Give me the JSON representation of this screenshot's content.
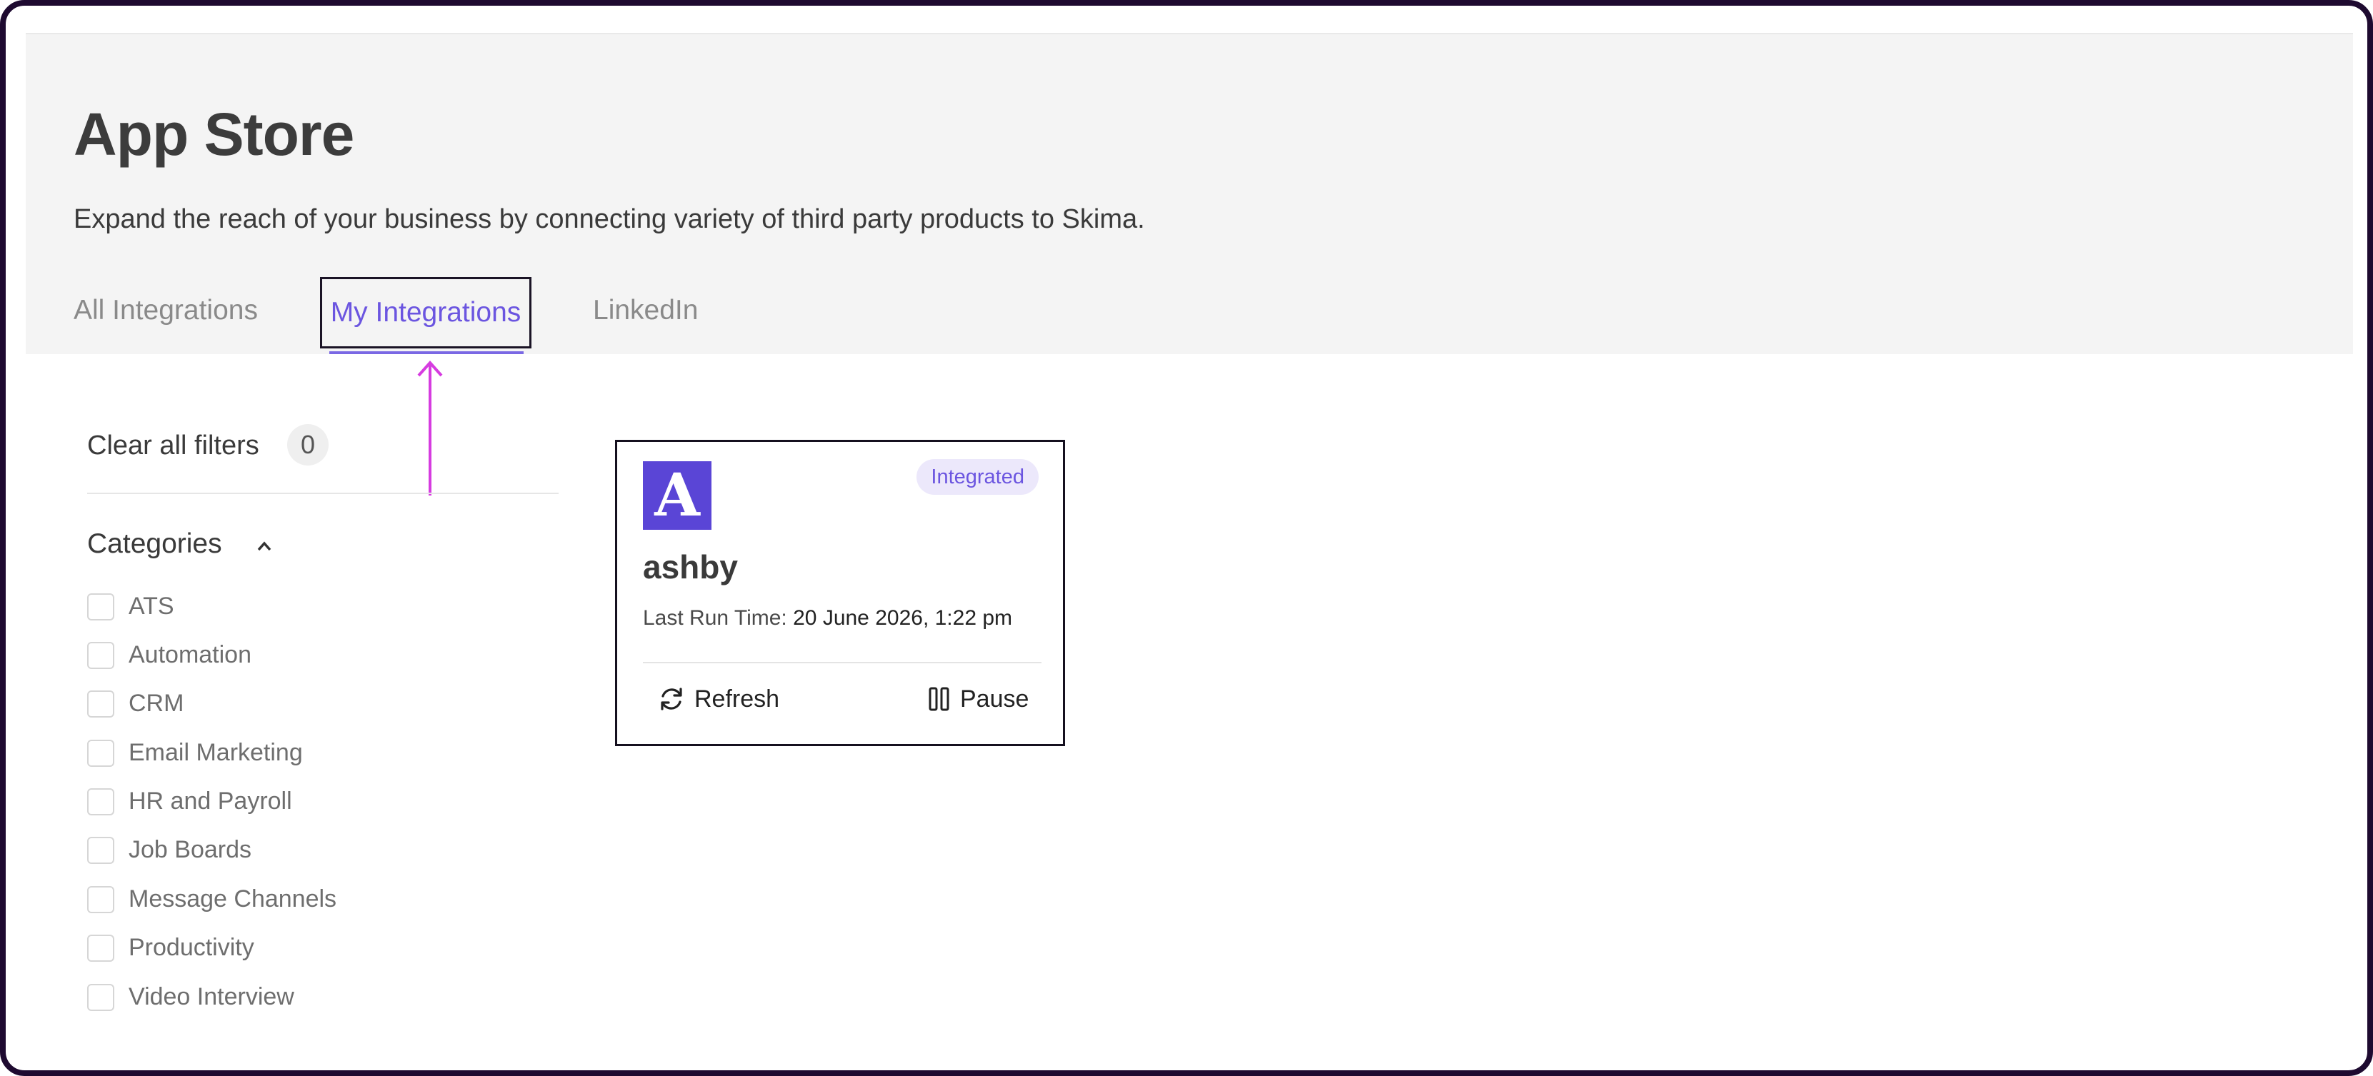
{
  "page": {
    "title": "App Store",
    "subtitle": "Expand the reach of your business by connecting variety of third party products to Skima."
  },
  "tabs": [
    {
      "label": "All Integrations",
      "active": false
    },
    {
      "label": "My Integrations",
      "active": true
    },
    {
      "label": "LinkedIn",
      "active": false
    }
  ],
  "filters": {
    "clear_label": "Clear all filters",
    "count": "0",
    "categories_title": "Categories",
    "categories": [
      "ATS",
      "Automation",
      "CRM",
      "Email Marketing",
      "HR and Payroll",
      "Job Boards",
      "Message Channels",
      "Productivity",
      "Video Interview"
    ]
  },
  "card": {
    "logo_letter": "A",
    "badge": "Integrated",
    "name": "ashby",
    "last_run_label": "Last Run Time:",
    "last_run_value": "20 June 2026, 1:22 pm",
    "refresh_label": "Refresh",
    "pause_label": "Pause"
  },
  "colors": {
    "accent": "#6b55e0",
    "logo_bg": "#5a45d6",
    "annotation_arrow": "#d63ce0"
  }
}
